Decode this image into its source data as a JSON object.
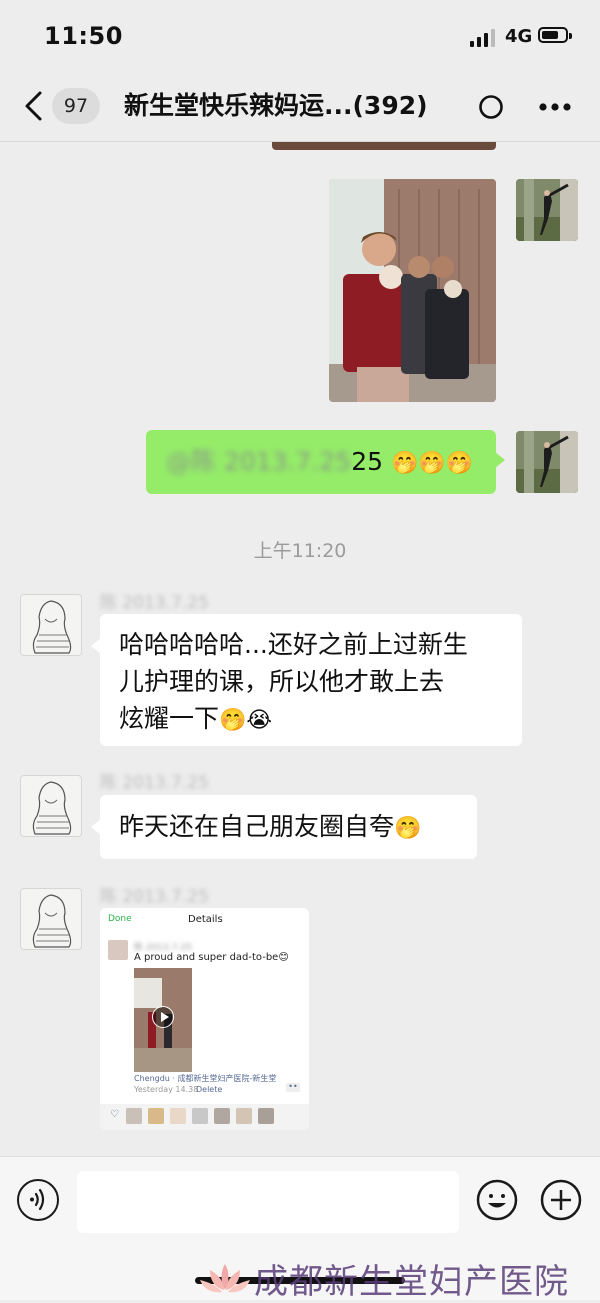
{
  "status_bar": {
    "time": "11:50",
    "network": "4G"
  },
  "nav": {
    "back_count": "97",
    "title": "新生堂快乐辣妈运...(392)"
  },
  "messages": {
    "outgoing_text_visible": "@陈   2013.7.25",
    "outgoing_text_end": "25",
    "outgoing_emojis": "🤭🤭🤭",
    "timestamp": "上午11:20",
    "sender_name": "陈   2013.7.25",
    "msg1_line1": "哈哈哈哈哈...还好之前上过新生",
    "msg1_line2": "儿护理的课，所以他才敢上去",
    "msg1_line3": "炫耀一下",
    "msg1_emojis": "🤭😭",
    "msg2_text": "昨天还在自己朋友圈自夸",
    "msg2_emojis": "🤭"
  },
  "moments_card": {
    "done": "Done",
    "details": "Details",
    "caption": "A proud and super dad-to-be😊",
    "location": "Chengdu · 成都新生堂妇产医院-新生堂",
    "time": "Yesterday 14.38",
    "delete": "Delete",
    "more": "••"
  },
  "watermark": {
    "text": "成都新生堂妇产医院"
  },
  "colors": {
    "background": "#ededed",
    "bubble_green": "#95ec69",
    "bubble_white": "#ffffff",
    "link_blue": "#576b95"
  }
}
